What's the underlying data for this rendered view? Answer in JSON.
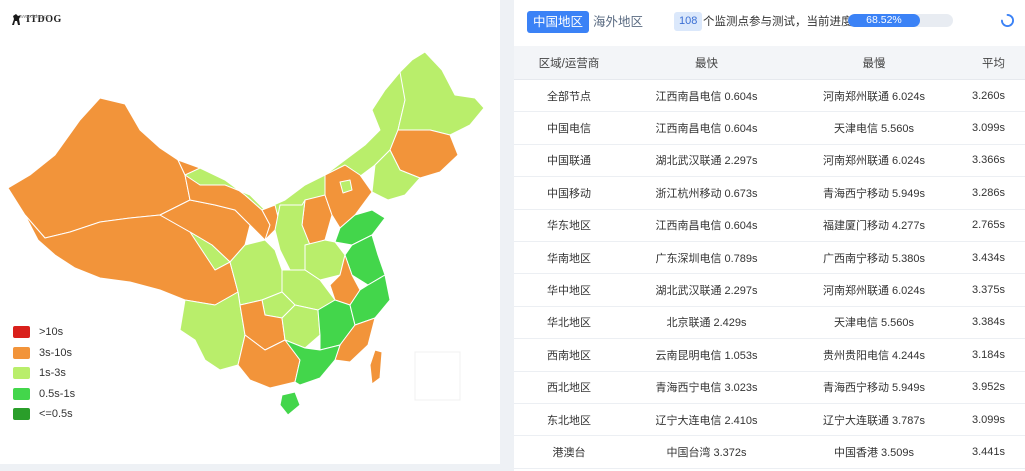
{
  "brand": {
    "logo_text": "ITDOG",
    "logo_sub": "www.itdog.cn"
  },
  "legend": [
    {
      "label": ">10s",
      "color": "#d9201b"
    },
    {
      "label": "3s-10s",
      "color": "#f2943a"
    },
    {
      "label": "1s-3s",
      "color": "#b9ee6b"
    },
    {
      "label": "0.5s-1s",
      "color": "#43d64b"
    },
    {
      "label": "<=0.5s",
      "color": "#2a9e2a"
    }
  ],
  "tabs": {
    "active": "中国地区",
    "inactive": "海外地区"
  },
  "status": {
    "node_count": "108",
    "count_text": "个监测点参与测试，当前进度：",
    "progress_label": "68.52%",
    "progress_value": 0.6852
  },
  "table": {
    "headers": {
      "region": "区域/运营商",
      "fastest": "最快",
      "slowest": "最慢",
      "average": "平均"
    },
    "rows": [
      {
        "region": "全部节点",
        "fastest": "江西南昌电信 0.604s",
        "slowest": "河南郑州联通 6.024s",
        "average": "3.260s"
      },
      {
        "region": "中国电信",
        "fastest": "江西南昌电信 0.604s",
        "slowest": "天津电信 5.560s",
        "average": "3.099s"
      },
      {
        "region": "中国联通",
        "fastest": "湖北武汉联通 2.297s",
        "slowest": "河南郑州联通 6.024s",
        "average": "3.366s"
      },
      {
        "region": "中国移动",
        "fastest": "浙江杭州移动 0.673s",
        "slowest": "青海西宁移动 5.949s",
        "average": "3.286s"
      },
      {
        "region": "华东地区",
        "fastest": "江西南昌电信 0.604s",
        "slowest": "福建厦门移动 4.277s",
        "average": "2.765s"
      },
      {
        "region": "华南地区",
        "fastest": "广东深圳电信 0.789s",
        "slowest": "广西南宁移动 5.380s",
        "average": "3.434s"
      },
      {
        "region": "华中地区",
        "fastest": "湖北武汉联通 2.297s",
        "slowest": "河南郑州联通 6.024s",
        "average": "3.375s"
      },
      {
        "region": "华北地区",
        "fastest": "北京联通 2.429s",
        "slowest": "天津电信 5.560s",
        "average": "3.384s"
      },
      {
        "region": "西南地区",
        "fastest": "云南昆明电信 1.053s",
        "slowest": "贵州贵阳电信 4.244s",
        "average": "3.184s"
      },
      {
        "region": "西北地区",
        "fastest": "青海西宁电信 3.023s",
        "slowest": "青海西宁移动 5.949s",
        "average": "3.952s"
      },
      {
        "region": "东北地区",
        "fastest": "辽宁大连电信 2.410s",
        "slowest": "辽宁大连联通 3.787s",
        "average": "3.099s"
      },
      {
        "region": "港澳台",
        "fastest": "中国台湾 3.372s",
        "slowest": "中国香港 3.509s",
        "average": "3.441s"
      }
    ]
  },
  "colors": {
    "accent": "#3b82f6",
    "orange": "#f2943a",
    "lightgreen": "#b9ee6b",
    "green": "#43d64b"
  }
}
